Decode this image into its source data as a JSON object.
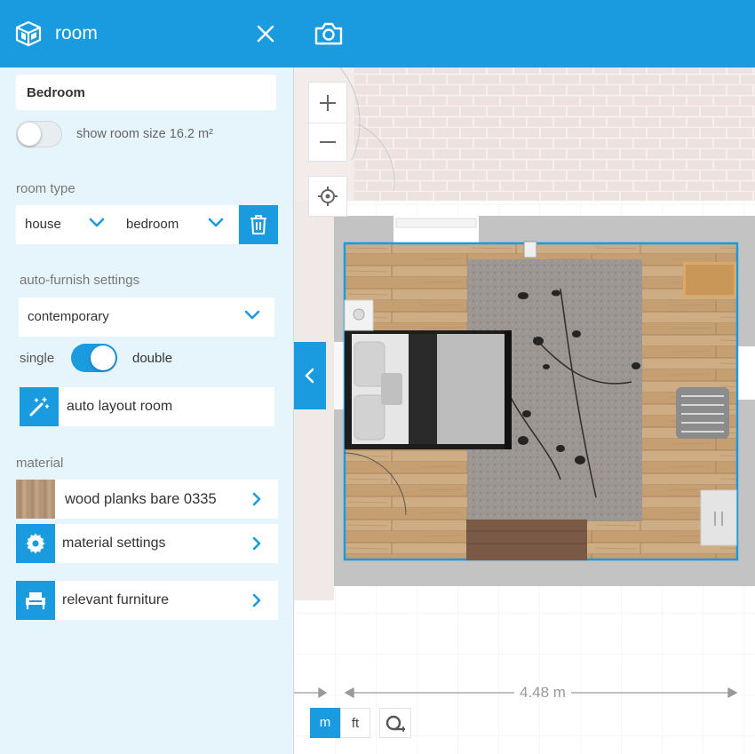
{
  "panel": {
    "title": "room",
    "room_name": "Bedroom",
    "show_size_label": "show room size 16.2 m²",
    "room_type_label": "room type",
    "room_type": {
      "category": "house",
      "subtype": "bedroom"
    },
    "autofurnish_label": "auto-furnish settings",
    "style": "contemporary",
    "bed_toggle": {
      "left": "single",
      "right": "double",
      "selected": "double"
    },
    "auto_layout_label": "auto layout room",
    "material_label": "material",
    "material_name": "wood planks bare 0335",
    "material_settings_label": "material settings",
    "relevant_furniture_label": "relevant furniture"
  },
  "canvas": {
    "dimension_label": "4.48 m",
    "units": {
      "metric": "m",
      "imperial": "ft",
      "active": "m"
    }
  },
  "colors": {
    "accent": "#1a9be0",
    "panel_bg": "#e6f4fb",
    "wall": "#c4c4c4",
    "floor_wood": "#c9a57a",
    "rug": "#9a9590",
    "brick": "#ede2df"
  },
  "icons": [
    "room-cube-icon",
    "close-icon",
    "camera-icon",
    "chevron-down-icon",
    "trash-icon",
    "magic-wand-icon",
    "gear-icon",
    "armchair-icon",
    "chevron-right-icon",
    "zoom-in-icon",
    "zoom-out-icon",
    "locate-icon",
    "chevron-left-icon",
    "tape-measure-icon"
  ]
}
